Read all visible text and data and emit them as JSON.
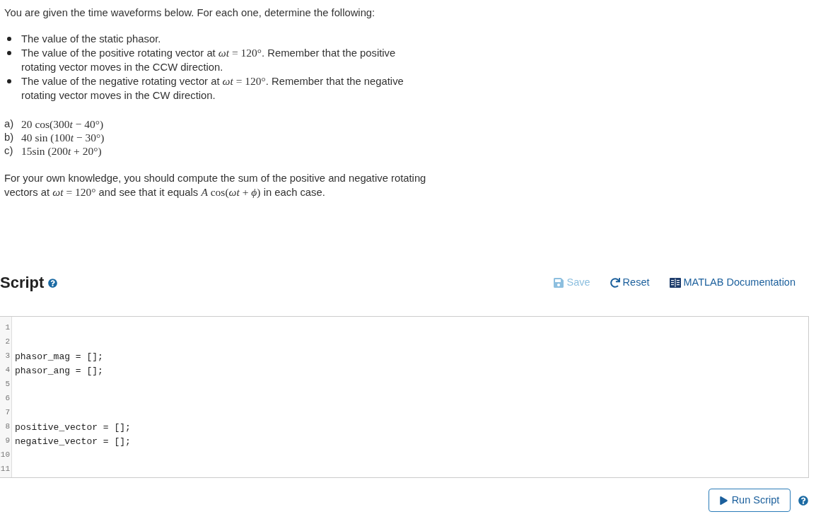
{
  "intro": "You are given the time waveforms below. For each one, determine the following:",
  "bullets": [
    {
      "runs": [
        {
          "kind": "text",
          "text": "The value of the static phasor."
        }
      ]
    },
    {
      "runs": [
        {
          "kind": "text",
          "text": "The value of the positive rotating vector at "
        },
        {
          "kind": "math",
          "text": "*ωt* = 120°"
        },
        {
          "kind": "text",
          "text": ". Remember that the positive rotating vector moves in the CCW direction."
        }
      ]
    },
    {
      "runs": [
        {
          "kind": "text",
          "text": "The value of the negative rotating vector at "
        },
        {
          "kind": "math",
          "text": "*ωt* = 120°"
        },
        {
          "kind": "text",
          "text": ". Remember that the negative rotating vector moves in the CW direction."
        }
      ]
    }
  ],
  "waveforms": [
    {
      "label": "a)",
      "formula": [
        {
          "kind": "roman",
          "text": "20 cos(300"
        },
        {
          "kind": "italic",
          "text": "t"
        },
        {
          "kind": "roman",
          "text": " − 40°)"
        }
      ]
    },
    {
      "label": "b)",
      "formula": [
        {
          "kind": "roman",
          "text": "40 sin (100"
        },
        {
          "kind": "italic",
          "text": "t"
        },
        {
          "kind": "roman",
          "text": " − 30°)"
        }
      ]
    },
    {
      "label": "c)",
      "formula": [
        {
          "kind": "roman",
          "text": "15sin (200"
        },
        {
          "kind": "italic",
          "text": "t"
        },
        {
          "kind": "roman",
          "text": " + 20°)"
        }
      ]
    }
  ],
  "note": {
    "runs": [
      {
        "kind": "text",
        "text": "For your own knowledge, you should compute the sum of the positive and negative rotating vectors at "
      },
      {
        "kind": "math",
        "text": "*ωt* = 120°"
      },
      {
        "kind": "text",
        "text": " and see that it equals "
      },
      {
        "kind": "math",
        "text": "*A* cos(*ωt* + *ϕ*)"
      },
      {
        "kind": "text",
        "text": " in each case."
      }
    ]
  },
  "script": {
    "title": "Script",
    "actions": [
      {
        "kind": "save",
        "label": "Save",
        "disabled": true
      },
      {
        "kind": "reset",
        "label": "Reset",
        "disabled": false
      },
      {
        "kind": "docs",
        "label": "MATLAB Documentation",
        "disabled": false
      }
    ],
    "lines": [
      {
        "number": "1"
      },
      {
        "number": "2"
      },
      {
        "number": "3",
        "code": "phasor_mag = [];"
      },
      {
        "number": "4",
        "code": "phasor_ang = [];"
      },
      {
        "number": "5"
      },
      {
        "number": "6"
      },
      {
        "number": "7"
      },
      {
        "number": "8",
        "code": "positive_vector = [];"
      },
      {
        "number": "9",
        "code": "negative_vector = [];"
      },
      {
        "number": "10"
      },
      {
        "number": "11"
      }
    ],
    "run_button": "Run Script"
  }
}
